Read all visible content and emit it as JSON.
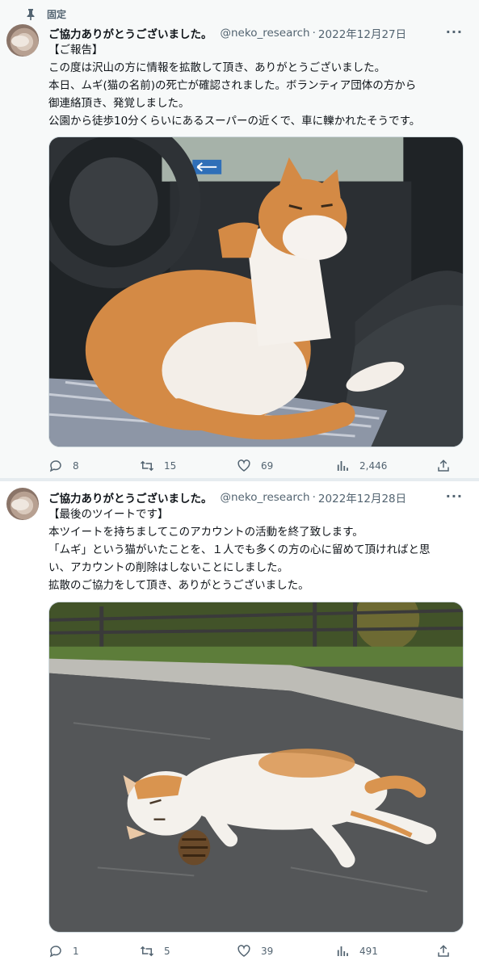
{
  "tweets": [
    {
      "pinned_label": "固定",
      "display_name": "ご協力ありがとうございました。",
      "handle": "@neko_research",
      "separator": "·",
      "date": "2022年12月27日",
      "more": "···",
      "lines": [
        "【ご報告】",
        "この度は沢山の方に情報を拡散して頂き、ありがとうございました。",
        "本日、ムギ(猫の名前)の死亡が確認されました。ボランティア団体の方から",
        "御連絡頂き、発覚しました。",
        "公園から徒歩10分くらいにあるスーパーの近くで、車に轢かれたそうです。"
      ],
      "image_icon": "orange-white-cat-in-car-seat",
      "replies": "8",
      "retweets": "15",
      "likes": "69",
      "views": "2,446"
    },
    {
      "display_name": "ご協力ありがとうございました。",
      "handle": "@neko_research",
      "separator": "·",
      "date": "2022年12月28日",
      "more": "···",
      "lines": [
        "【最後のツイートです】",
        "本ツイートを持ちましてこのアカウントの活動を終了致します。",
        "「ムギ」という猫がいたことを、１人でも多くの方の心に留めて頂ければと思",
        "い、アカウントの削除はしないことにしました。",
        "拡散のご協力をして頂き、ありがとうございました。"
      ],
      "image_icon": "cat-lying-on-pavement-with-pinecone",
      "replies": "1",
      "retweets": "5",
      "likes": "39",
      "views": "491"
    }
  ]
}
